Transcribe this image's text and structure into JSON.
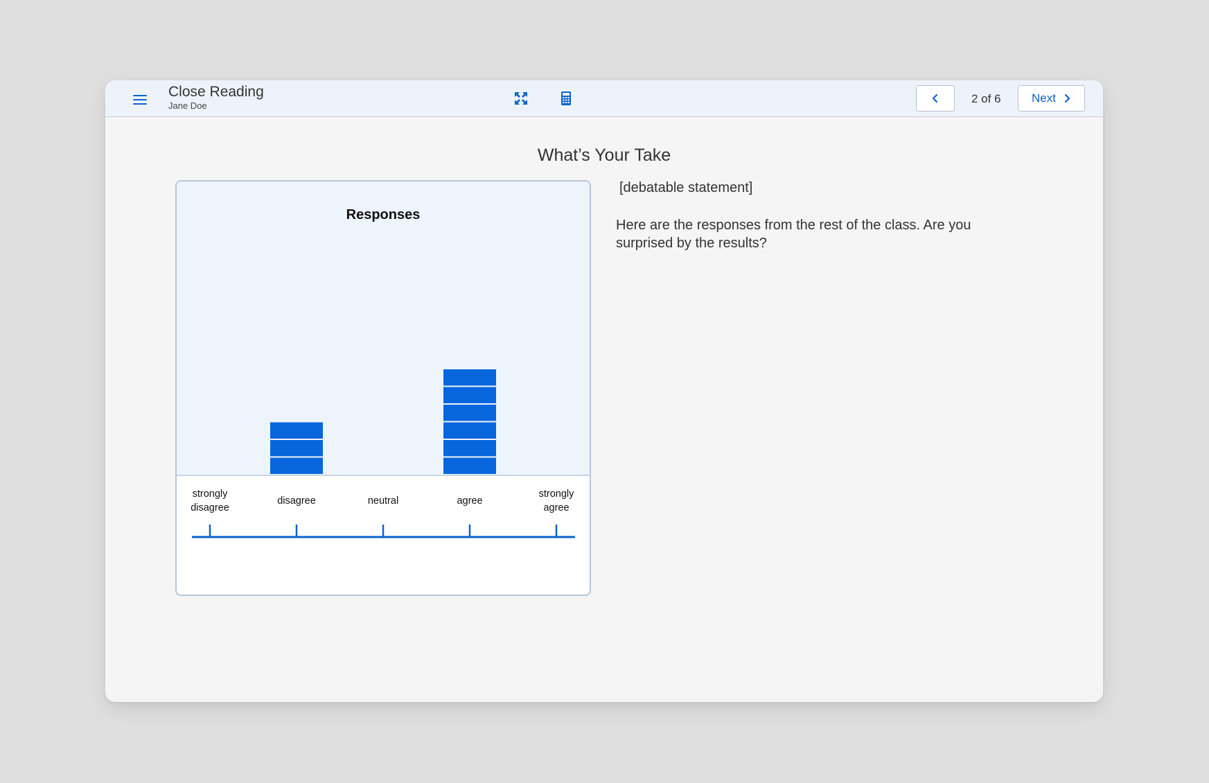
{
  "header": {
    "title": "Close Reading",
    "student_name": "Jane Doe",
    "page_indicator": "2 of 6",
    "next_label": "Next"
  },
  "icons": {
    "menu": "hamburger-menu-icon",
    "fullscreen": "expand-arrows-icon",
    "calculator": "calculator-icon",
    "prev": "chevron-left-icon",
    "next": "chevron-right-icon"
  },
  "colors": {
    "accent": "#0b63ce",
    "bar": "#0866dd",
    "plot_background": "#eef4fc",
    "card_border": "#b8c7da"
  },
  "page": {
    "title": "What’s Your Take",
    "statement": "[debatable statement]",
    "prompt": "Here are the responses from the rest of the class. Are you surprised by the results?"
  },
  "chart_data": {
    "type": "bar",
    "title": "Responses",
    "categories": [
      [
        "strongly",
        "disagree"
      ],
      [
        "disagree"
      ],
      [
        "neutral"
      ],
      [
        "agree"
      ],
      [
        "strongly",
        "agree"
      ]
    ],
    "values": [
      0,
      3,
      0,
      6,
      0
    ],
    "representation": "stacked unit blocks, one block per response",
    "grid": false
  }
}
